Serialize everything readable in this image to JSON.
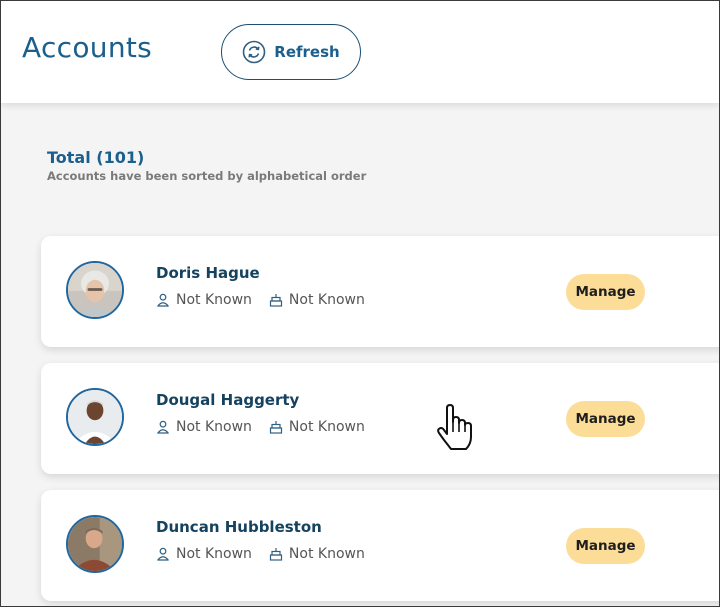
{
  "header": {
    "title": "Accounts",
    "refresh_label": "Refresh"
  },
  "summary": {
    "total": "Total (101)",
    "note": "Accounts have been sorted by alphabetical order"
  },
  "accounts": [
    {
      "name": "Doris Hague",
      "gender": "Not Known",
      "birthday": "Not Known",
      "manage_label": "Manage"
    },
    {
      "name": "Dougal Haggerty",
      "gender": "Not Known",
      "birthday": "Not Known",
      "manage_label": "Manage"
    },
    {
      "name": "Duncan Hubbleston",
      "gender": "Not Known",
      "birthday": "Not Known",
      "manage_label": "Manage"
    }
  ],
  "icons": {
    "refresh": "refresh-icon",
    "person": "person-icon",
    "cake": "cake-icon",
    "cursor": "hand-pointer-cursor"
  },
  "colors": {
    "brand": "#1b5f8c",
    "manage_bg": "#fcdd98",
    "avatar_border": "#2067a0"
  }
}
